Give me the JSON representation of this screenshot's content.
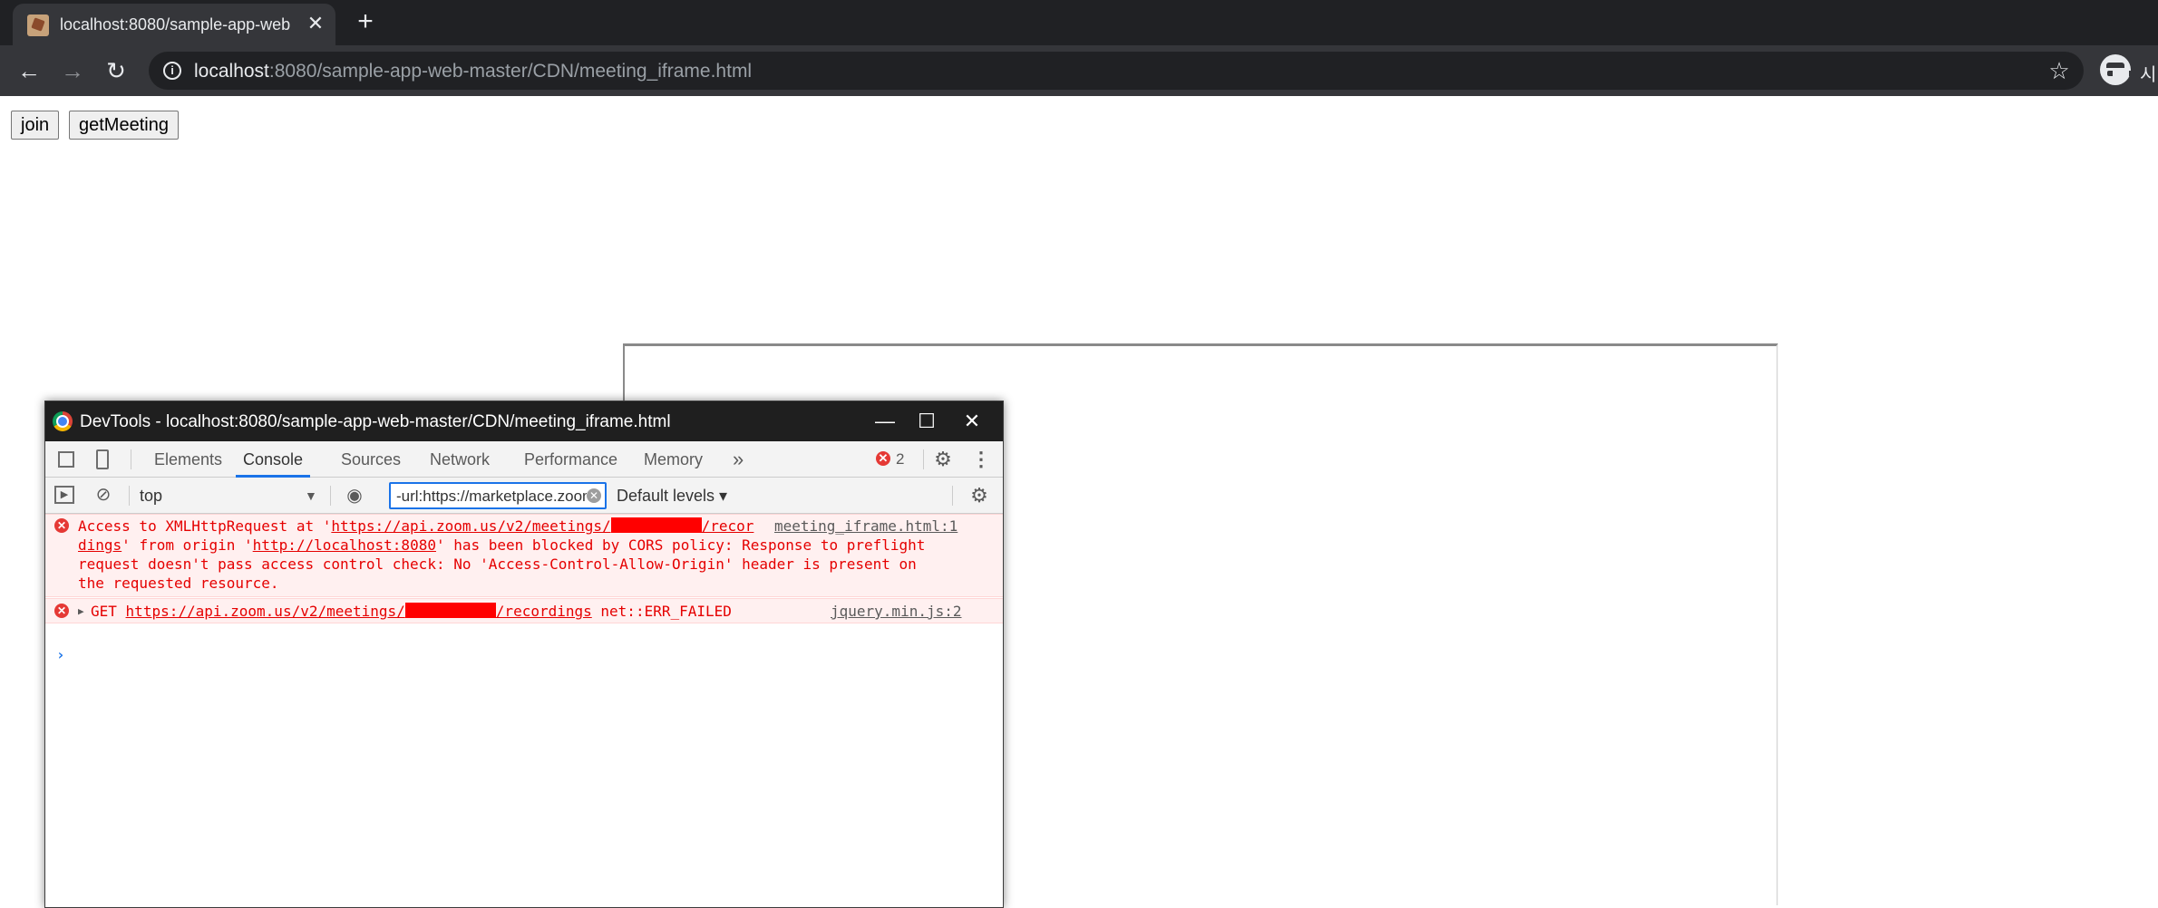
{
  "browser": {
    "tab_title": "localhost:8080/sample-app-web",
    "tab_close": "✕",
    "new_tab": "+",
    "url_host": "localhost",
    "url_rest": ":8080/sample-app-web-master/CDN/meeting_iframe.html",
    "profile_text": "시",
    "icons": {
      "back": "back-arrow-icon",
      "forward": "forward-arrow-icon",
      "reload": "reload-icon",
      "info": "info-icon",
      "bookmark": "star-icon",
      "incognito": "incognito-icon"
    }
  },
  "page": {
    "join_label": "join",
    "get_meeting_label": "getMeeting"
  },
  "devtools": {
    "window_title": "DevTools - localhost:8080/sample-app-web-master/CDN/meeting_iframe.html",
    "window_buttons": {
      "minimize": "—",
      "maximize": "☐",
      "close": "✕"
    },
    "tabs": [
      "Elements",
      "Console",
      "Sources",
      "Network",
      "Performance",
      "Memory"
    ],
    "active_tab": "Console",
    "more_tabs": "»",
    "error_count": "2",
    "console_toolbar": {
      "context": "top",
      "filter_value": "-url:https://marketplace.zoom.us",
      "levels": "Default levels ▾"
    },
    "messages": [
      {
        "level": "error",
        "lines": [
          {
            "pre": "Access to XMLHttpRequest at '",
            "link": "https://api.zoom.us/v2/meetings/",
            "redacted": true,
            "link2": "/recor"
          },
          {
            "link": "dings",
            "post": "' from origin '",
            "link3": "http://localhost:8080",
            "post2": "' has been blocked by CORS policy: Response to preflight"
          },
          {
            "text": "request doesn't pass access control check: No 'Access-Control-Allow-Origin' header is present on"
          },
          {
            "text": "the requested resource."
          }
        ],
        "source": "meeting_iframe.html:1"
      },
      {
        "level": "error",
        "method": "GET",
        "url_start": "https://api.zoom.us/v2/meetings/",
        "url_end": "/recordings",
        "status": "net::ERR_FAILED",
        "source": "jquery.min.js:2"
      }
    ],
    "prompt": "›",
    "colors": {
      "error_text": "#e50000",
      "error_bg": "#fff0f0",
      "accent": "#1a73e8"
    }
  }
}
